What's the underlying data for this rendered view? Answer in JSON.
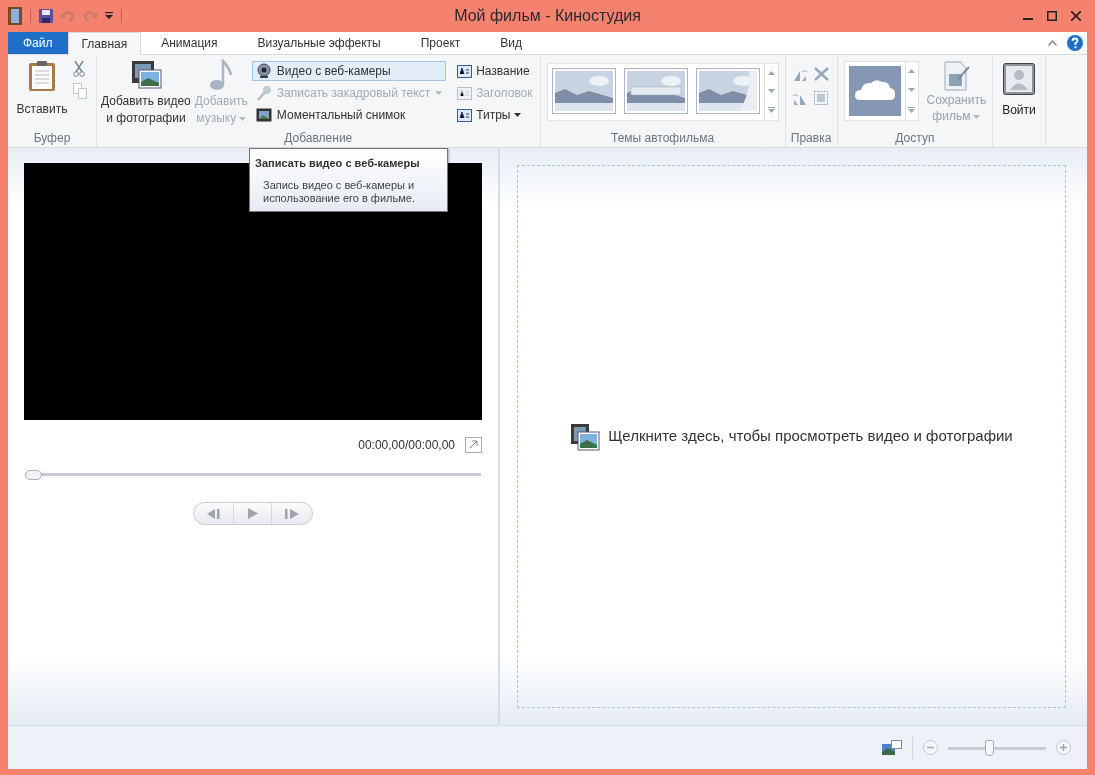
{
  "window": {
    "title": "Мой фильм - Киностудия"
  },
  "tabs": [
    {
      "label": "Файл",
      "kind": "file",
      "selected": false
    },
    {
      "label": "Главная",
      "kind": "tab",
      "selected": true
    },
    {
      "label": "Анимация",
      "kind": "tab",
      "selected": false
    },
    {
      "label": "Визуальные эффекты",
      "kind": "tab",
      "selected": false
    },
    {
      "label": "Проект",
      "kind": "tab",
      "selected": false
    },
    {
      "label": "Вид",
      "kind": "tab",
      "selected": false
    }
  ],
  "ribbon": {
    "clipboard": {
      "title": "Буфер",
      "paste": "Вставить",
      "copy_disabled": true
    },
    "add": {
      "title": "Добавление",
      "add_media": [
        "Добавить видео",
        "и фотографии"
      ],
      "add_music": {
        "lines": [
          "Добавить",
          "музыку"
        ],
        "disabled": true
      },
      "small": [
        {
          "label": "Видео с веб-камеры",
          "disabled": false,
          "highlighted": true,
          "menu": false
        },
        {
          "label": "Записать закадровый текст",
          "disabled": true,
          "highlighted": false,
          "menu": true
        },
        {
          "label": "Моментальный снимок",
          "disabled": false,
          "highlighted": false,
          "menu": false
        }
      ],
      "text": [
        {
          "label": "Название",
          "disabled": false,
          "menu": false
        },
        {
          "label": "Заголовок",
          "disabled": true,
          "menu": false
        },
        {
          "label": "Титры",
          "disabled": false,
          "menu": true
        }
      ]
    },
    "themes": {
      "title": "Темы автофильма",
      "items": [
        {
          "kind": "plain"
        },
        {
          "kind": "banner"
        },
        {
          "kind": "curl"
        }
      ]
    },
    "edit": {
      "title": "Правка"
    },
    "share": {
      "title": "Доступ",
      "save": {
        "lines": [
          "Сохранить",
          "фильм"
        ],
        "disabled": true
      }
    },
    "signin": {
      "label": "Войти"
    }
  },
  "tooltip": {
    "title": "Записать видео с веб-камеры",
    "body": [
      "Запись видео с веб-камеры и",
      "использование его в фильме."
    ]
  },
  "preview": {
    "time": "00:00,00/00:00,00",
    "seek": {
      "level": 0
    }
  },
  "storyboard": {
    "hint": "Щелкните здесь, чтобы просмотреть видео и фотографии"
  },
  "status_bar": {
    "zoom": {
      "level": 0.42
    }
  }
}
